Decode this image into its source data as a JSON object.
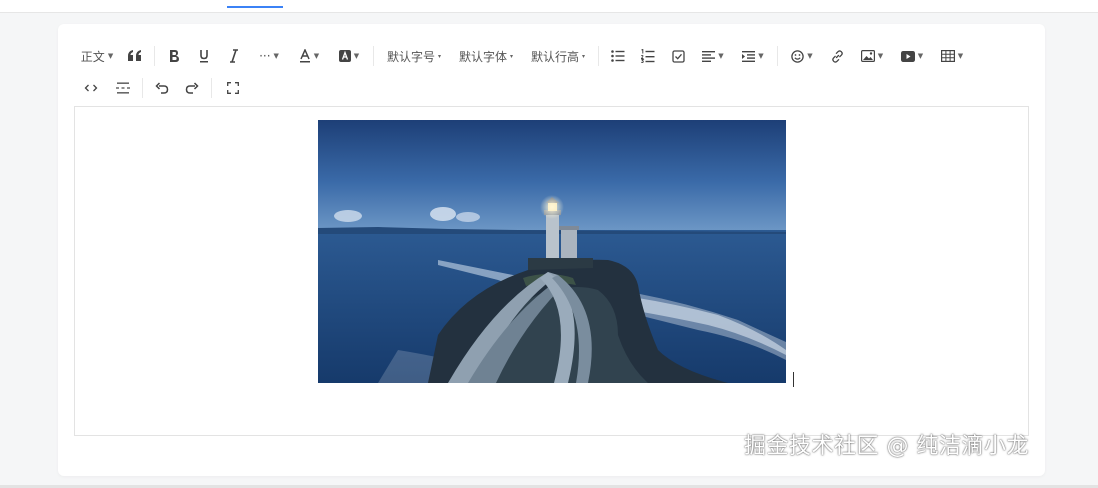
{
  "toolbar": {
    "heading": "正文",
    "more": "···",
    "font_size": "默认字号",
    "font_family": "默认字体",
    "line_height": "默认行高"
  },
  "editor": {
    "image": "lighthouse-photo"
  },
  "watermark": "掘金技术社区 @ 纯洁滴小龙",
  "colors": {
    "accent": "#3b82f6",
    "border": "#e3e3e3",
    "background": "#f5f6f7"
  },
  "icons": [
    "quote-icon",
    "bold-icon",
    "underline-icon",
    "italic-icon",
    "font-color-icon",
    "bg-color-icon",
    "bulleted-list-icon",
    "numbered-list-icon",
    "todo-icon",
    "justify-icon",
    "indent-icon",
    "emotion-icon",
    "link-icon",
    "image-icon",
    "video-icon",
    "table-icon",
    "code-block-icon",
    "divider-icon",
    "undo-icon",
    "redo-icon",
    "fullscreen-icon"
  ]
}
